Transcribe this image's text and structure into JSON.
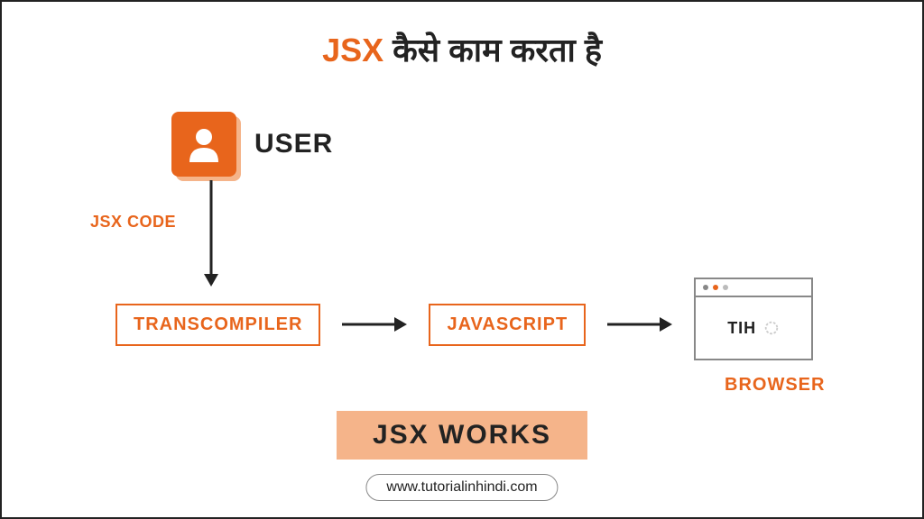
{
  "title": {
    "jsx": "JSX",
    "rest": " कैसे काम करता है"
  },
  "user_label": "USER",
  "jsx_code_label": "JSX CODE",
  "boxes": {
    "transcompiler": "TRANSCOMPILER",
    "javascript": "JAVASCRIPT"
  },
  "browser": {
    "tih": "TIH",
    "label": "BROWSER"
  },
  "footer_badge": "JSX WORKS",
  "url": "www.tutorialinhindi.com",
  "colors": {
    "accent": "#e8651c",
    "light": "#f5b48a",
    "dark": "#222"
  }
}
